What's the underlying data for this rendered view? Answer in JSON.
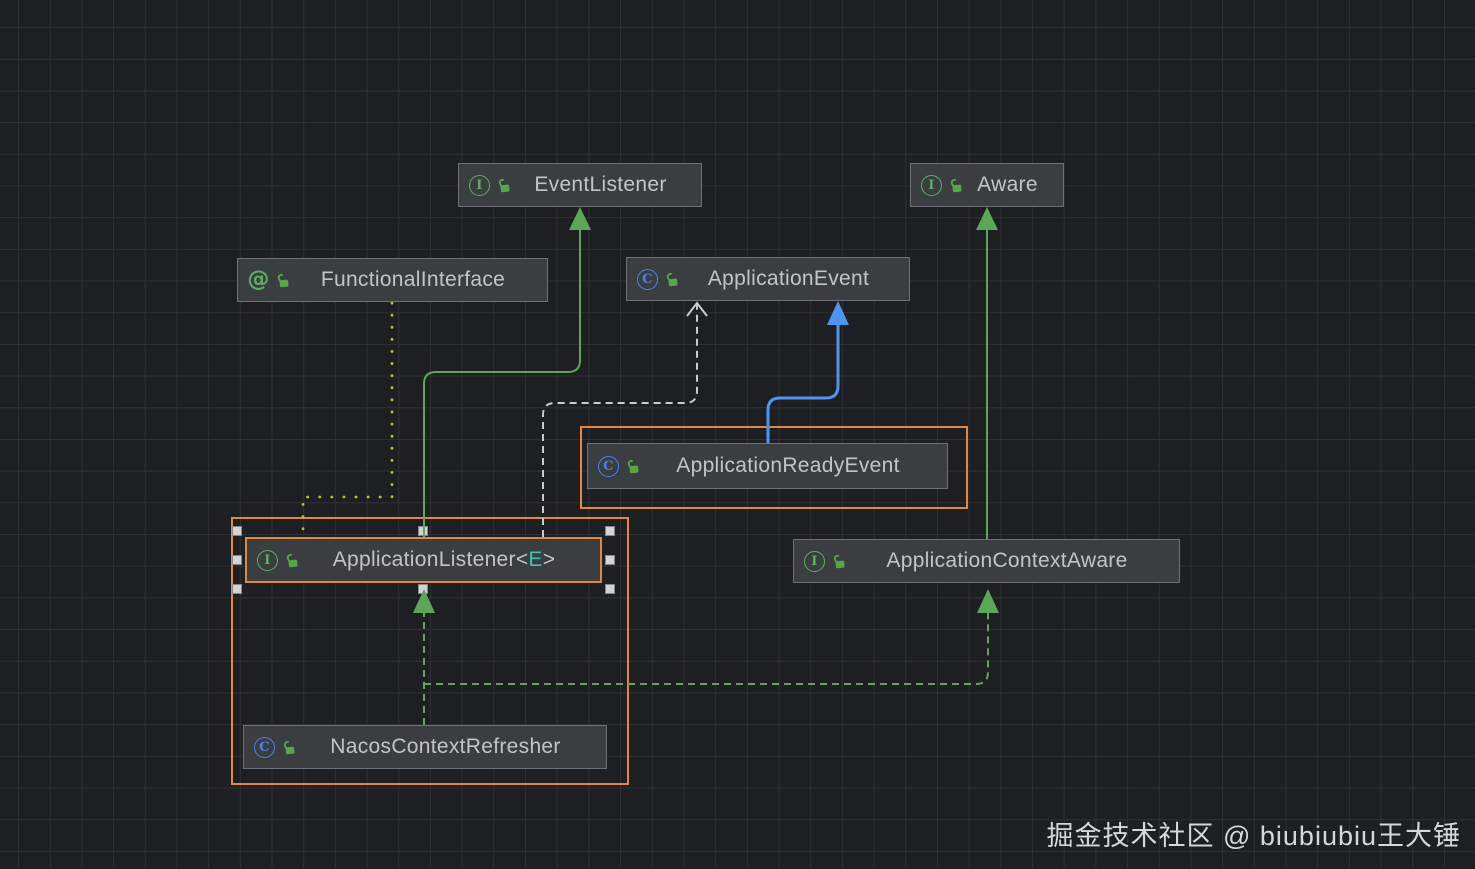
{
  "diagram": {
    "tool": "uml-class-diagram",
    "nodes": {
      "event_listener": {
        "label": "EventListener",
        "kind": "interface",
        "icon_letter": "I",
        "visibility": "public"
      },
      "aware": {
        "label": "Aware",
        "kind": "interface",
        "icon_letter": "I",
        "visibility": "public"
      },
      "functional_interface": {
        "label": "FunctionalInterface",
        "kind": "annotation",
        "icon_letter": "@",
        "visibility": "public"
      },
      "application_event": {
        "label": "ApplicationEvent",
        "kind": "class",
        "icon_letter": "C",
        "visibility": "public"
      },
      "application_ready_event": {
        "label": "ApplicationReadyEvent",
        "kind": "class",
        "icon_letter": "C",
        "visibility": "public",
        "highlighted": true
      },
      "application_listener": {
        "label_pre": "ApplicationListener<",
        "label_param": "E",
        "label_post": ">",
        "kind": "interface",
        "icon_letter": "I",
        "visibility": "public",
        "selected": true
      },
      "application_context_aware": {
        "label": "ApplicationContextAware",
        "kind": "interface",
        "icon_letter": "I",
        "visibility": "public"
      },
      "nacos_context_refresher": {
        "label": "NacosContextRefresher",
        "kind": "class",
        "icon_letter": "C",
        "visibility": "public",
        "highlighted": true
      }
    },
    "edges": [
      {
        "from": "ApplicationListener<E>",
        "to": "EventListener",
        "relation": "extends",
        "style": "solid-green"
      },
      {
        "from": "ApplicationContextAware",
        "to": "Aware",
        "relation": "extends",
        "style": "solid-green"
      },
      {
        "from": "ApplicationReadyEvent",
        "to": "ApplicationEvent",
        "relation": "extends",
        "style": "solid-blue"
      },
      {
        "from": "ApplicationListener<E>",
        "to": "ApplicationEvent",
        "relation": "dependency",
        "style": "dashed-white"
      },
      {
        "from": "FunctionalInterface",
        "to": "ApplicationListener<E>",
        "relation": "annotation",
        "style": "dotted-yellow"
      },
      {
        "from": "NacosContextRefresher",
        "to": "ApplicationListener<E>",
        "relation": "implements",
        "style": "dashed-green"
      },
      {
        "from": "NacosContextRefresher",
        "to": "ApplicationContextAware",
        "relation": "implements",
        "style": "dashed-green"
      }
    ]
  },
  "watermark": {
    "text": "掘金技术社区 @ biubiubiu王大锤"
  },
  "colors": {
    "bg": "#1e1f22",
    "grid": "#2e3134",
    "node-fill": "#3b3e41",
    "node-border": "#6e7276",
    "text": "#c2c4c8",
    "orange": "#e5873b",
    "green": "#5aa758",
    "green-dash": "#63a35f",
    "blue": "#4f95f0",
    "white-line": "#c9cbcd",
    "yellow": "#bcbc3e",
    "teal": "#3fc3ad",
    "icon-green": "#5fad65",
    "icon-blue": "#4c82ee",
    "lock-green": "#57a64a",
    "handle": "#d2d4d6",
    "watermark": "#d6d7d8"
  }
}
